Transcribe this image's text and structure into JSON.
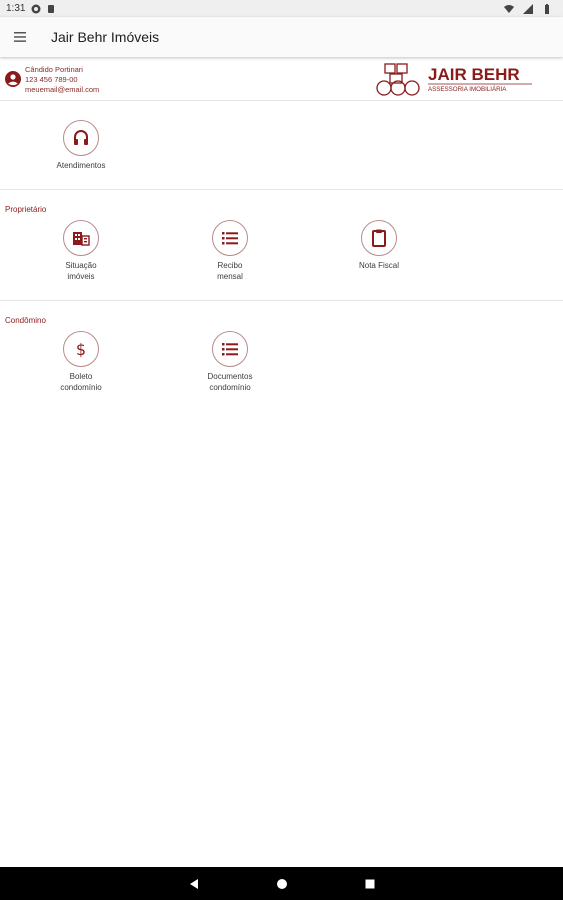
{
  "status_bar": {
    "time": "1:31"
  },
  "app_bar": {
    "title": "Jair Behr Imóveis",
    "menu_icon": "hamburger-icon"
  },
  "profile": {
    "name": "Cândido Portinari",
    "phone": "123 456 789-00",
    "email": "meuemail@email.com"
  },
  "brand": {
    "name": "JAIR BEHR",
    "tagline": "ASSESSORIA IMOBILIÁRIA"
  },
  "colors": {
    "accent": "#8b1a1a",
    "tile_border": "#b98b8b",
    "icon": "#8b1a1a"
  },
  "top_tiles": [
    {
      "label": "Atendimentos",
      "icon": "headset-icon"
    }
  ],
  "sections": {
    "proprietario": {
      "title": "Proprietário",
      "tiles": [
        {
          "label": "Situação\nimóveis",
          "icon": "building-icon"
        },
        {
          "label": "Recibo\nmensal",
          "icon": "list-icon"
        },
        {
          "label": "Nota Fiscal",
          "icon": "clipboard-icon"
        }
      ]
    },
    "condominio": {
      "title": "Condômino",
      "tiles": [
        {
          "label": "Boleto\ncondomínio",
          "icon": "dollar-icon"
        },
        {
          "label": "Documentos\ncondomínio",
          "icon": "list-icon"
        }
      ]
    }
  },
  "nav_bar": {
    "back": "back-icon",
    "home": "home-icon",
    "recents": "recents-icon"
  }
}
